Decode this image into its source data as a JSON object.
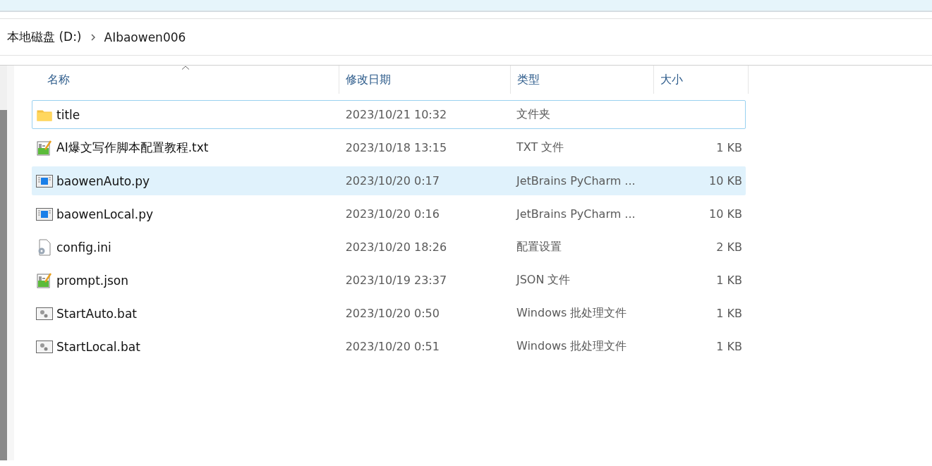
{
  "breadcrumb": [
    {
      "label": "本地磁盘 (D:)"
    },
    {
      "label": "AIbaowen006"
    }
  ],
  "columns": [
    {
      "label": "名称",
      "sorted": true
    },
    {
      "label": "修改日期",
      "sorted": false
    },
    {
      "label": "类型",
      "sorted": false
    },
    {
      "label": "大小",
      "sorted": false
    }
  ],
  "files": [
    {
      "kind": "folder",
      "name": "title",
      "modified": "2023/10/21 10:32",
      "type": "文件夹",
      "focused": true,
      "hovered": false
    },
    {
      "kind": "text",
      "name": "AI爆文写作脚本配置教程.txt",
      "modified": "2023/10/18 13:15",
      "type": "TXT 文件",
      "size": "1 KB",
      "focused": false,
      "hovered": false
    },
    {
      "kind": "script",
      "name": "baowenAuto.py",
      "modified": "2023/10/20 0:17",
      "type": "JetBrains PyCharm ...",
      "size": "10 KB",
      "focused": false,
      "hovered": true
    },
    {
      "kind": "script",
      "name": "baowenLocal.py",
      "modified": "2023/10/20 0:16",
      "type": "JetBrains PyCharm ...",
      "size": "10 KB",
      "focused": false,
      "hovered": false
    },
    {
      "kind": "settings",
      "name": "config.ini",
      "modified": "2023/10/20 18:26",
      "type": "配置设置",
      "size": "2 KB",
      "focused": false,
      "hovered": false
    },
    {
      "kind": "text",
      "name": "prompt.json",
      "modified": "2023/10/19 23:37",
      "type": "JSON 文件",
      "size": "1 KB",
      "focused": false,
      "hovered": false
    },
    {
      "kind": "batch",
      "name": "StartAuto.bat",
      "modified": "2023/10/20 0:50",
      "type": "Windows 批处理文件",
      "size": "1 KB",
      "focused": false,
      "hovered": false
    },
    {
      "kind": "batch",
      "name": "StartLocal.bat",
      "modified": "2023/10/20 0:51",
      "type": "Windows 批处理文件",
      "size": "1 KB",
      "focused": false,
      "hovered": false
    }
  ]
}
